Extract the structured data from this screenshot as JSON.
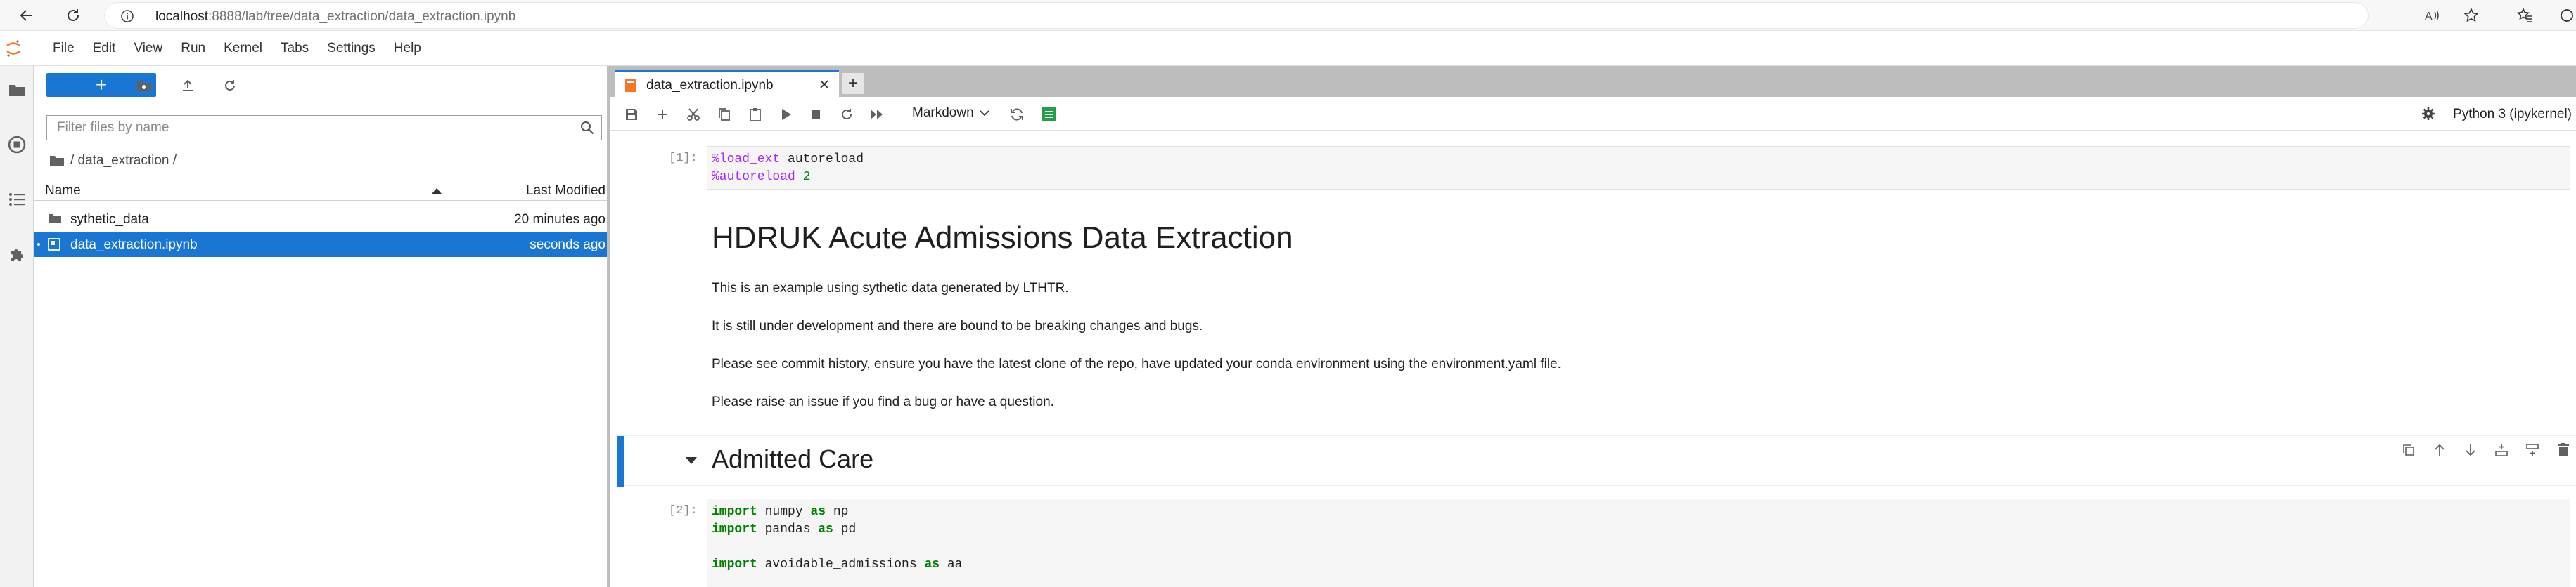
{
  "browser": {
    "url_host": "localhost",
    "url_path": ":8888/lab/tree/data_extraction/data_extraction.ipynb"
  },
  "menu": [
    "File",
    "Edit",
    "View",
    "Run",
    "Kernel",
    "Tabs",
    "Settings",
    "Help"
  ],
  "filebrowser": {
    "new_label": "+",
    "filter_placeholder": "Filter files by name",
    "breadcrumb": "/ data_extraction /",
    "col_name": "Name",
    "col_modified": "Last Modified",
    "rows": [
      {
        "name": "sythetic_data",
        "modified": "20 minutes ago",
        "icon": "folder-icon"
      },
      {
        "name": "data_extraction.ipynb",
        "modified": "seconds ago",
        "icon": "notebook-icon",
        "selected": true
      }
    ]
  },
  "notebook": {
    "tab_label": "data_extraction.ipynb",
    "new_tab": "+",
    "cell_type": "Markdown",
    "kernel": "Python 3 (ipykernel)",
    "cell1_prompt": "[1]:",
    "cell1_line1_magic": "%load_ext",
    "cell1_line1_rest": " autoreload",
    "cell1_line2_magic": "%autoreload",
    "cell1_line2_num": "2",
    "title": "HDRUK Acute Admissions Data Extraction",
    "para1": "This is an example using sythetic data generated by LTHTR.",
    "para2": "It is still under development and there are bound to be breaking changes and bugs.",
    "para3": "Please see commit history, ensure you have the latest clone of the repo, have updated your conda environment using the environment.yaml file.",
    "para4": "Please raise an issue if you find a bug or have a question.",
    "heading2": "Admitted Care",
    "cell2_prompt": "[2]:",
    "cell2_l1_kw": "import",
    "cell2_l1_mod": " numpy ",
    "cell2_l1_as": "as",
    "cell2_l1_alias": " np",
    "cell2_l2_kw": "import",
    "cell2_l2_mod": " pandas ",
    "cell2_l2_as": "as",
    "cell2_l2_alias": " pd",
    "cell2_l3_kw": "import",
    "cell2_l3_mod": " avoidable_admissions ",
    "cell2_l3_as": "as",
    "cell2_l3_alias": " aa"
  },
  "colors": {
    "accent": "#1976d2",
    "notebook_orange": "#f37726"
  }
}
